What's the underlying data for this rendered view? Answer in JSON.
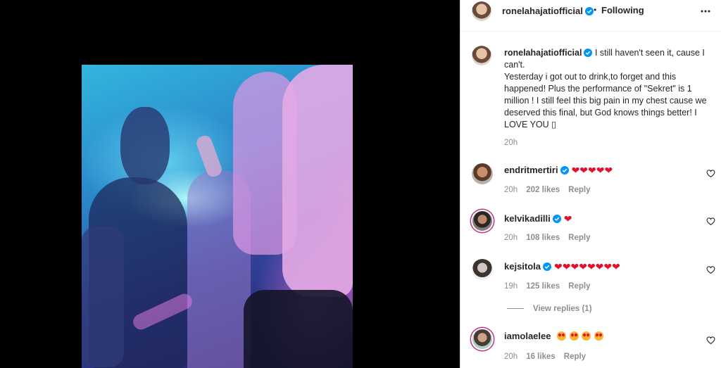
{
  "post": {
    "author": "ronelahajatiofficial",
    "separator": "•",
    "follow_status": "Following",
    "more_icon": "more-horizontal-icon",
    "caption": {
      "author": "ronelahajatiofficial",
      "lines": [
        "I still haven't seen it, cause I",
        "can't.",
        "Yesterday i got out to drink,to forget and this",
        "happened! Plus the performance of \"Sekret\" is 1",
        "million ! I still feel this big pain in my chest cause we",
        "deserved this final, but God knows things better! I",
        "LOVE YOU ▯"
      ],
      "time": "20h"
    }
  },
  "comments": [
    {
      "user": "endritmertiri",
      "verified": true,
      "text": "❤❤❤❤❤",
      "time": "20h",
      "likes": "202 likes",
      "reply": "Reply"
    },
    {
      "user": "kelvikadilli",
      "verified": true,
      "text": "❤",
      "time": "20h",
      "likes": "108 likes",
      "reply": "Reply"
    },
    {
      "user": "kejsitola",
      "verified": true,
      "text": "❤❤❤❤❤❤❤❤",
      "time": "19h",
      "likes": "125 likes",
      "reply": "Reply",
      "view_replies": "View replies (1)"
    },
    {
      "user": "iamolaelee",
      "verified": false,
      "emoji_count": 4,
      "emoji_name": "heart-eyes-emoji",
      "time": "20h",
      "likes": "16 likes",
      "reply": "Reply"
    }
  ],
  "colors": {
    "verified": "#0095f6",
    "heart": "#e3102d",
    "secondary_text": "#8e8e8e",
    "story_ring": "#c13584"
  }
}
